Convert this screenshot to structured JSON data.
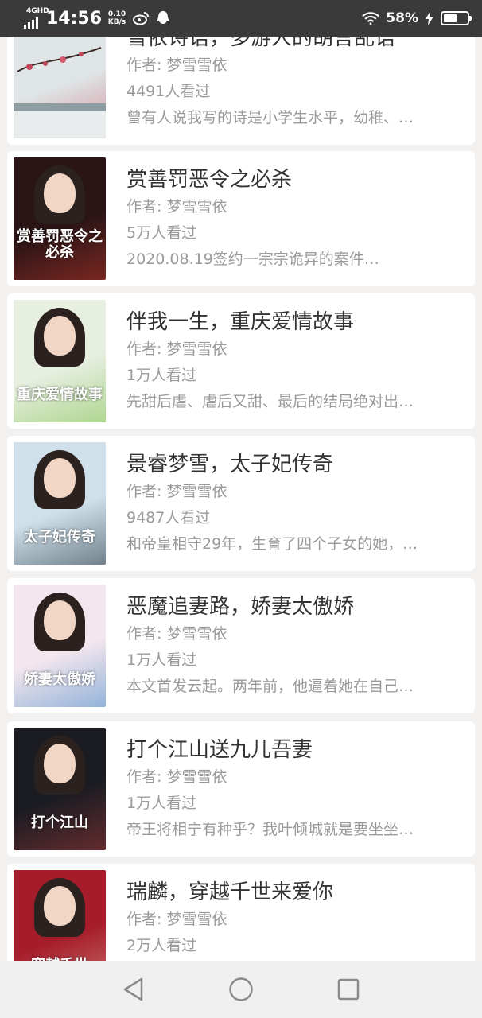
{
  "status_bar": {
    "network": "4GHD",
    "time": "14:56",
    "speed_value": "0.10",
    "speed_unit": "KB/s",
    "battery_percent": "58%",
    "battery_level": 0.58,
    "icons": [
      "signal-icon",
      "weibo-icon",
      "qq-icon",
      "wifi-icon",
      "charging-icon",
      "battery-icon"
    ]
  },
  "books": [
    {
      "title": "雪依诗语，多游人的胡言乱语",
      "author": "作者: 梦雪雪依",
      "views": "4491人看过",
      "desc": "曾有人说我写的诗是小学生水平，幼稚、…",
      "cover": {
        "bg": "#dfe5e6",
        "accent": "#c4475a",
        "text": ""
      }
    },
    {
      "title": "赏善罚恶令之必杀",
      "author": "作者: 梦雪雪依",
      "views": "5万人看过",
      "desc": "2020.08.19签约一宗宗诡异的案件…",
      "cover": {
        "bg": "#2a1416",
        "accent": "#c0392b",
        "text": "赏善罚恶令之必杀"
      }
    },
    {
      "title": "伴我一生，重庆爱情故事",
      "author": "作者: 梦雪雪依",
      "views": "1万人看过",
      "desc": "先甜后虐、虐后又甜、最后的结局绝对出…",
      "cover": {
        "bg": "#e7efe0",
        "accent": "#7cc049",
        "text": "重庆爱情故事"
      }
    },
    {
      "title": "景睿梦雪，太子妃传奇",
      "author": "作者: 梦雪雪依",
      "views": "9487人看过",
      "desc": "和帝皇相守29年，生育了四个子女的她，…",
      "cover": {
        "bg": "#cfe0ea",
        "accent": "#1f2d3a",
        "text": "太子妃传奇"
      }
    },
    {
      "title": "恶魔追妻路，娇妻太傲娇",
      "author": "作者: 梦雪雪依",
      "views": "1万人看过",
      "desc": "本文首发云起。两年前，他逼着她在自己…",
      "cover": {
        "bg": "#f3e6ee",
        "accent": "#3d86c6",
        "text": "娇妻太傲娇"
      }
    },
    {
      "title": "打个江山送九儿吾妻",
      "author": "作者: 梦雪雪依",
      "views": "1万人看过",
      "desc": "帝王将相宁有种乎？我叶倾城就是要坐坐…",
      "cover": {
        "bg": "#1b1c22",
        "accent": "#a33a3a",
        "text": "打个江山"
      }
    },
    {
      "title": "瑞麟，穿越千世来爱你",
      "author": "作者: 梦雪雪依",
      "views": "2万人看过",
      "desc": "",
      "cover": {
        "bg": "#a51d2b",
        "accent": "#e8b8a8",
        "text": "穿越千世"
      }
    }
  ],
  "nav_bar": {
    "buttons": [
      "back-icon",
      "home-icon",
      "recents-icon"
    ]
  }
}
